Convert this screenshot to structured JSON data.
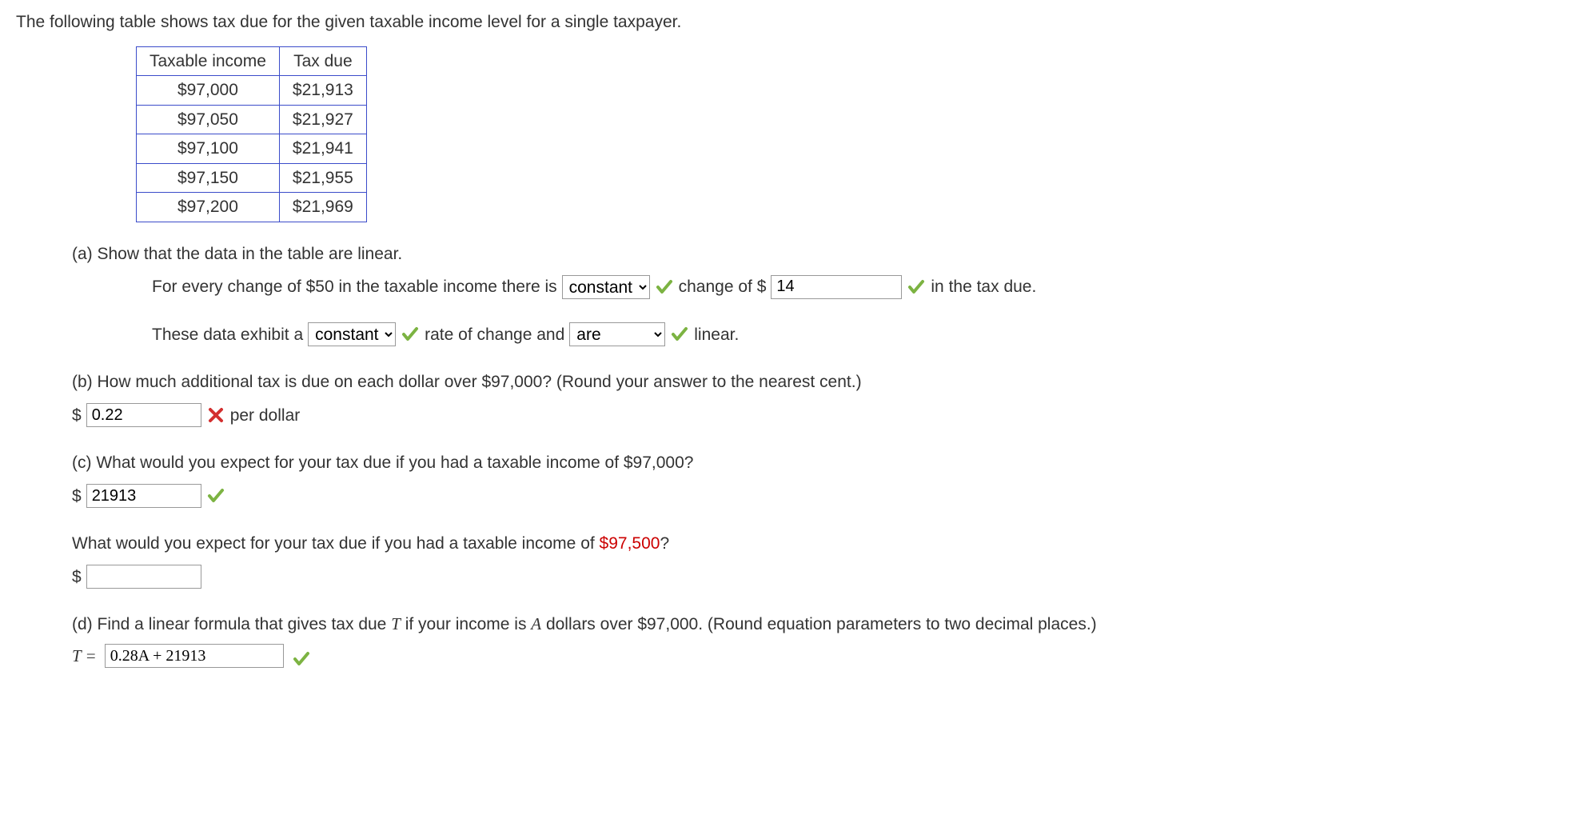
{
  "intro": "The following table shows tax due for the given taxable income level for a single taxpayer.",
  "table": {
    "headers": [
      "Taxable income",
      "Tax due"
    ],
    "rows": [
      [
        "$97,000",
        "$21,913"
      ],
      [
        "$97,050",
        "$21,927"
      ],
      [
        "$97,100",
        "$21,941"
      ],
      [
        "$97,150",
        "$21,955"
      ],
      [
        "$97,200",
        "$21,969"
      ]
    ]
  },
  "a": {
    "label": "(a) Show that the data in the table are linear.",
    "line1_pre": "For every change of $50 in the taxable income there is",
    "sel1_value": "constant",
    "line1_mid": "change of $",
    "input1_value": "14",
    "line1_post": "in the tax due.",
    "line2_pre": "These data exhibit a",
    "sel2_value": "constant",
    "line2_mid": "rate of change and",
    "sel3_value": "are",
    "line2_post": "linear."
  },
  "b": {
    "label": "(b) How much additional tax is due on each dollar over $97,000? (Round your answer to the nearest cent.)",
    "prefix": "$",
    "value": "0.22",
    "suffix": "per dollar"
  },
  "c": {
    "label": "(c) What would you expect for your tax due if you had a taxable income of $97,000?",
    "prefix": "$",
    "value": "21913"
  },
  "c2": {
    "label_pre": "What would you expect for your tax due if you had a taxable income of ",
    "highlight": "$97,500",
    "label_post": "?",
    "prefix": "$",
    "value": ""
  },
  "d": {
    "label": "(d) Find a linear formula that gives tax due T if your income is A dollars over $97,000. (Round equation parameters to two decimal places.)",
    "lhs": "T =",
    "value": "0.28A + 21913"
  }
}
